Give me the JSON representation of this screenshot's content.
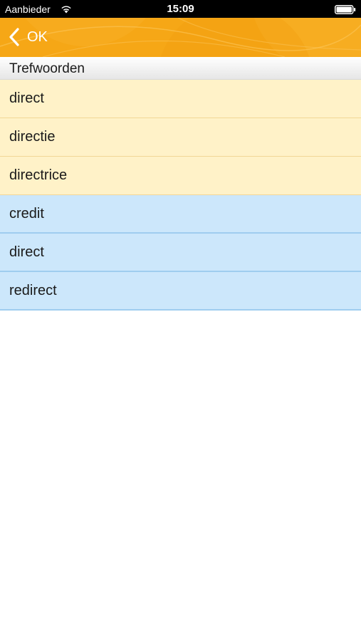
{
  "status_bar": {
    "carrier": "Aanbieder",
    "time": "15:09",
    "wifi_icon": "wifi-icon",
    "battery_icon": "battery-icon"
  },
  "nav_bar": {
    "back_label": "OK",
    "back_icon": "chevron-left-icon",
    "background_color": "#f6a716"
  },
  "section": {
    "title": "Trefwoorden"
  },
  "results": {
    "groups": [
      {
        "color": "#fff2c8",
        "items": [
          {
            "label": "direct"
          },
          {
            "label": "directie"
          },
          {
            "label": "directrice"
          }
        ]
      },
      {
        "color": "#cce7fb",
        "items": [
          {
            "label": "credit"
          },
          {
            "label": "direct"
          },
          {
            "label": "redirect"
          }
        ]
      }
    ]
  }
}
